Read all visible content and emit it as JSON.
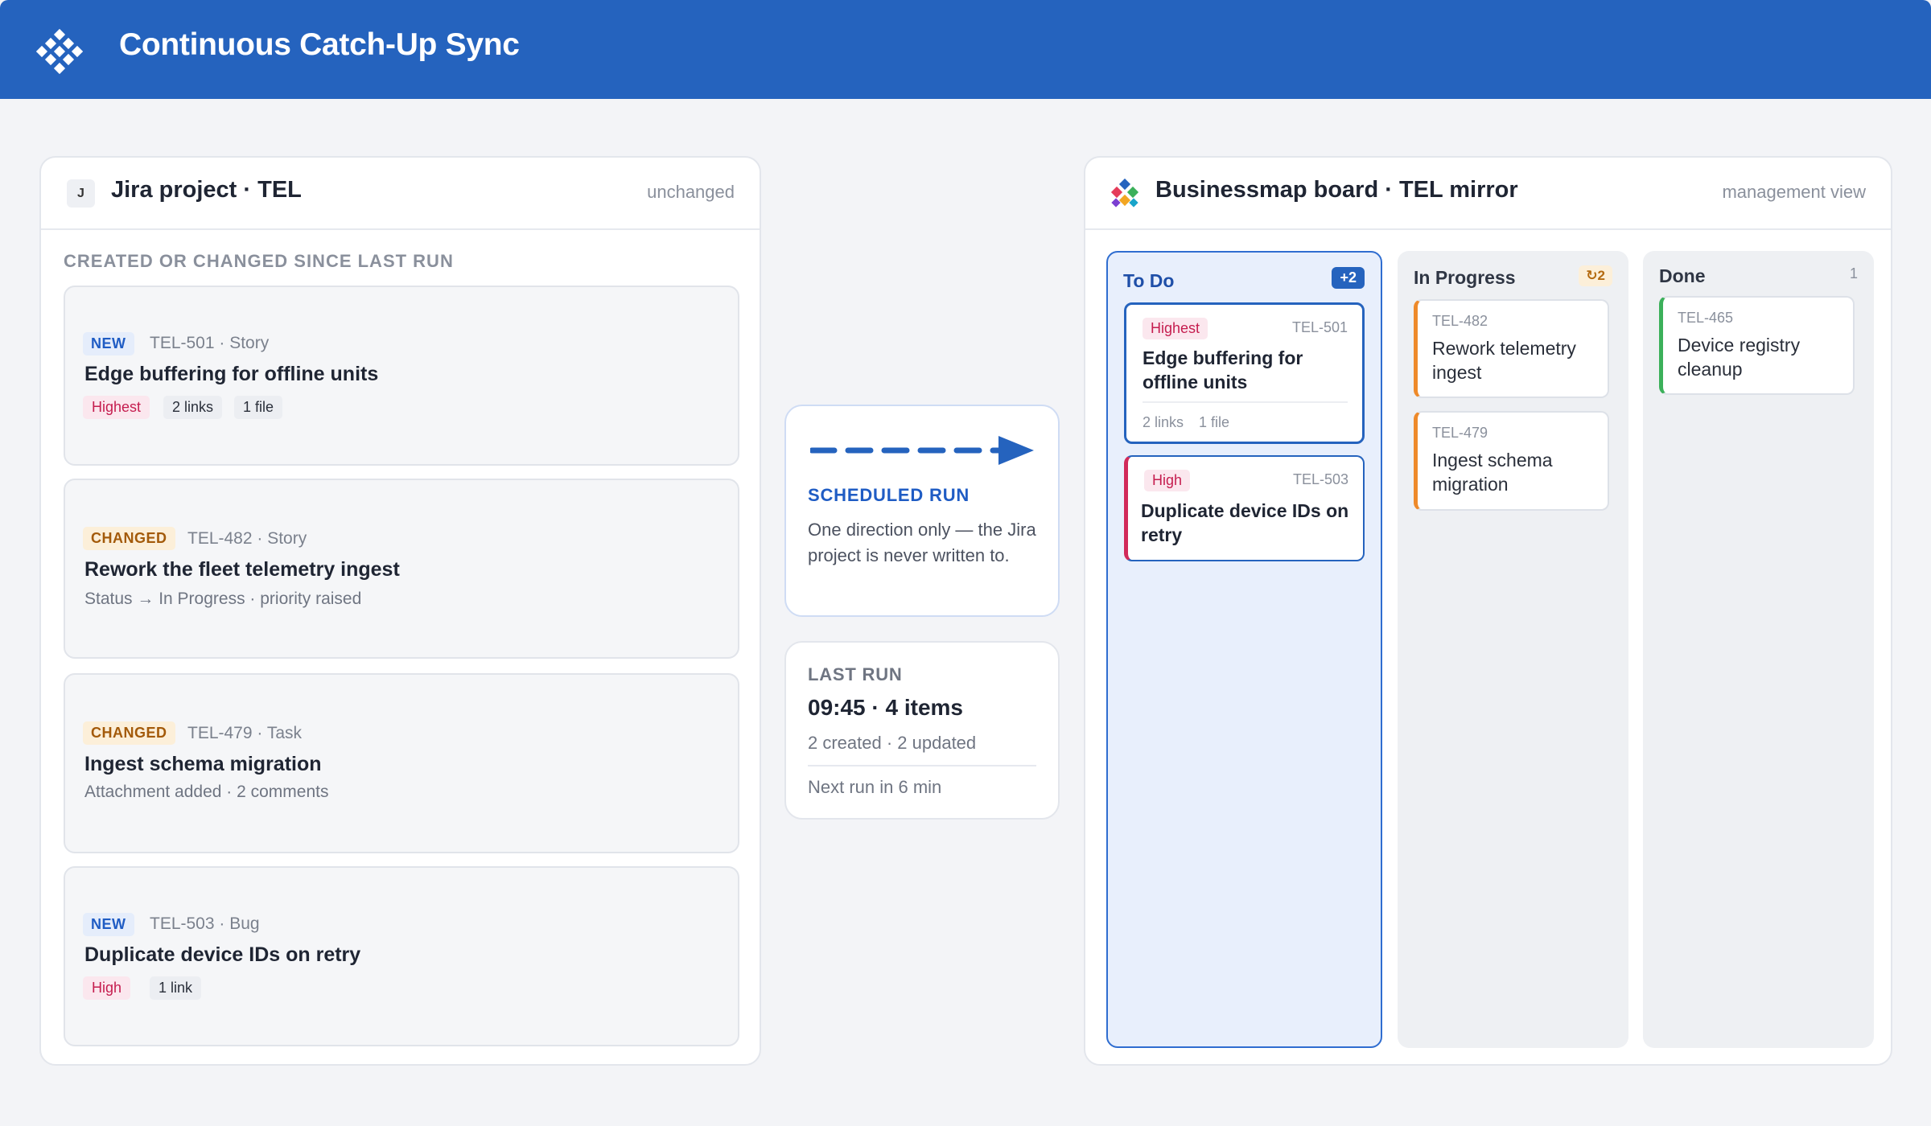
{
  "header": {
    "title": "Continuous Catch-Up Sync",
    "logo_icon": "diamond-grid-icon"
  },
  "jira": {
    "avatar": "J",
    "title": "Jira project · TEL",
    "meta": "unchanged",
    "section_label": "CREATED OR CHANGED SINCE LAST RUN",
    "items": [
      {
        "tag": "NEW",
        "key": "TEL-501 · Story",
        "title": "Edge buffering for offline units",
        "chips": [
          "Highest",
          "2 links",
          "1 file"
        ]
      },
      {
        "tag": "CHANGED",
        "key": "TEL-482 · Story",
        "title": "Rework the fleet telemetry ingest",
        "detail": "Status → In Progress · priority raised"
      },
      {
        "tag": "CHANGED",
        "key": "TEL-479 · Task",
        "title": "Ingest schema migration",
        "detail": "Attachment added · 2 comments"
      },
      {
        "tag": "NEW",
        "key": "TEL-503 · Bug",
        "title": "Duplicate device IDs on retry",
        "chips": [
          "High",
          "1 link"
        ]
      }
    ]
  },
  "scheduled": {
    "label": "SCHEDULED RUN",
    "description": "One direction only — the Jira project is never written to."
  },
  "last_run": {
    "label": "LAST RUN",
    "value": "09:45 · 4 items",
    "detail": "2 created · 2 updated",
    "next": "Next run in 6 min"
  },
  "board": {
    "title": "Businessmap board · TEL mirror",
    "meta": "management view",
    "columns": [
      {
        "name": "To Do",
        "badge": "+2",
        "cards": [
          {
            "priority": "Highest",
            "key": "TEL-501",
            "title": "Edge buffering for offline units",
            "links": "2 links",
            "files": "1 file"
          },
          {
            "priority": "High",
            "key": "TEL-503",
            "title": "Duplicate device IDs on retry"
          }
        ]
      },
      {
        "name": "In Progress",
        "badge": "↻2",
        "cards": [
          {
            "key": "TEL-482",
            "title": "Rework telemetry ingest"
          },
          {
            "key": "TEL-479",
            "title": "Ingest schema migration"
          }
        ]
      },
      {
        "name": "Done",
        "badge": "1",
        "cards": [
          {
            "key": "TEL-465",
            "title": "Device registry cleanup"
          }
        ]
      }
    ]
  },
  "colors": {
    "brand": "#2563be",
    "new": "#1f5cc4",
    "changed": "#a35a0a",
    "priority": "#c51d4f",
    "in_progress": "#ee8a2a",
    "done": "#3bb05a"
  }
}
